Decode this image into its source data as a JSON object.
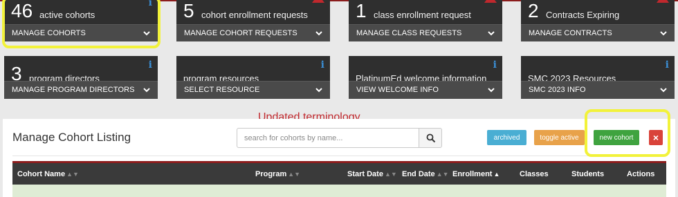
{
  "tiles": [
    {
      "count": "46",
      "label": "active cohorts",
      "action": "MANAGE COHORTS",
      "flag": "info"
    },
    {
      "count": "5",
      "label": "cohort enrollment requests",
      "action": "MANAGE COHORT REQUESTS",
      "flag": "warning"
    },
    {
      "count": "1",
      "label": "class enrollment request",
      "action": "MANAGE CLASS REQUESTS",
      "flag": "warning"
    },
    {
      "count": "2",
      "label": "Contracts Expiring",
      "action": "MANAGE CONTRACTS",
      "flag": "warning"
    },
    {
      "count": "3",
      "label": "program directors",
      "action": "MANAGE PROGRAM DIRECTORS",
      "flag": "info"
    },
    {
      "count": "",
      "label": "program resources",
      "action": "SELECT RESOURCE",
      "flag": "info"
    },
    {
      "count": "",
      "label": "PlatinumEd welcome information",
      "action": "VIEW WELCOME INFO",
      "flag": "info"
    },
    {
      "count": "",
      "label": "SMC 2023 Resources",
      "action": "SMC 2023 INFO",
      "flag": "info"
    }
  ],
  "annotation": "Updated terminology",
  "listing": {
    "title": "Manage Cohort Listing",
    "search_placeholder": "search for cohorts by name...",
    "buttons": {
      "archived": "archived",
      "toggle_active": "toggle active",
      "new_cohort": "new cohort",
      "close": "×"
    },
    "columns": [
      {
        "label": "Cohort Name",
        "sort": "both"
      },
      {
        "label": "Program",
        "sort": "both"
      },
      {
        "label": "Start Date",
        "sort": "both"
      },
      {
        "label": "End Date",
        "sort": "both"
      },
      {
        "label": "Enrollment",
        "sort": "asc"
      },
      {
        "label": "Classes",
        "sort": "none"
      },
      {
        "label": "Students",
        "sort": "none"
      },
      {
        "label": "Actions",
        "sort": "none"
      }
    ]
  },
  "colors": {
    "tile_bg": "#2f2f2f",
    "tile_bar": "#4a4a4a",
    "info": "#3b8fd6",
    "warning": "#c0282d",
    "highlight": "#f2f23a",
    "archived": "#4aaed3",
    "toggle_active": "#e8a24a",
    "new_cohort": "#3fa33f",
    "close": "#d9433a",
    "header_rule": "#8b1c1c"
  }
}
